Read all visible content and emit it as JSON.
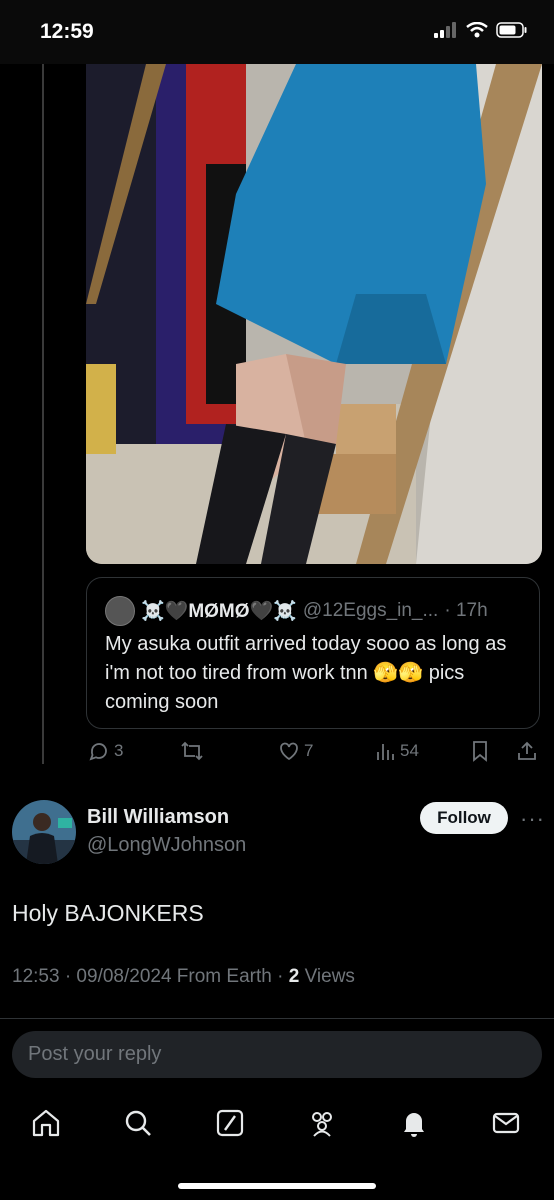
{
  "status_bar": {
    "time": "12:59"
  },
  "quoted_tweet": {
    "display_name": "☠️🖤MØMØ🖤☠️",
    "handle": "@12Eggs_in_...",
    "age": "· 17h",
    "text": "My asuka outfit arrived today sooo as long as i'm not too tired from work tnn 🫣🫣 pics coming soon"
  },
  "action_bar": {
    "replies": "3",
    "likes": "7",
    "views": "54"
  },
  "tweet": {
    "display_name": "Bill Williamson",
    "handle": "@LongWJohnson",
    "follow_label": "Follow",
    "text": "Holy BAJONKERS",
    "meta_prefix": "12:53 · 09/08/2024 From Earth · ",
    "views_count": "2",
    "views_label": " Views"
  },
  "reply_box": {
    "placeholder": "Post your reply"
  },
  "colors": {
    "background": "#000000",
    "muted": "#71767b",
    "text": "#e7e9ea",
    "follow_bg": "#eff3f4"
  },
  "icons": [
    "signal-icon",
    "wifi-icon",
    "battery-icon",
    "reply-icon",
    "retweet-icon",
    "like-icon",
    "views-icon",
    "bookmark-icon",
    "share-icon",
    "home-icon",
    "search-icon",
    "grok-icon",
    "communities-icon",
    "notifications-icon",
    "messages-icon"
  ]
}
